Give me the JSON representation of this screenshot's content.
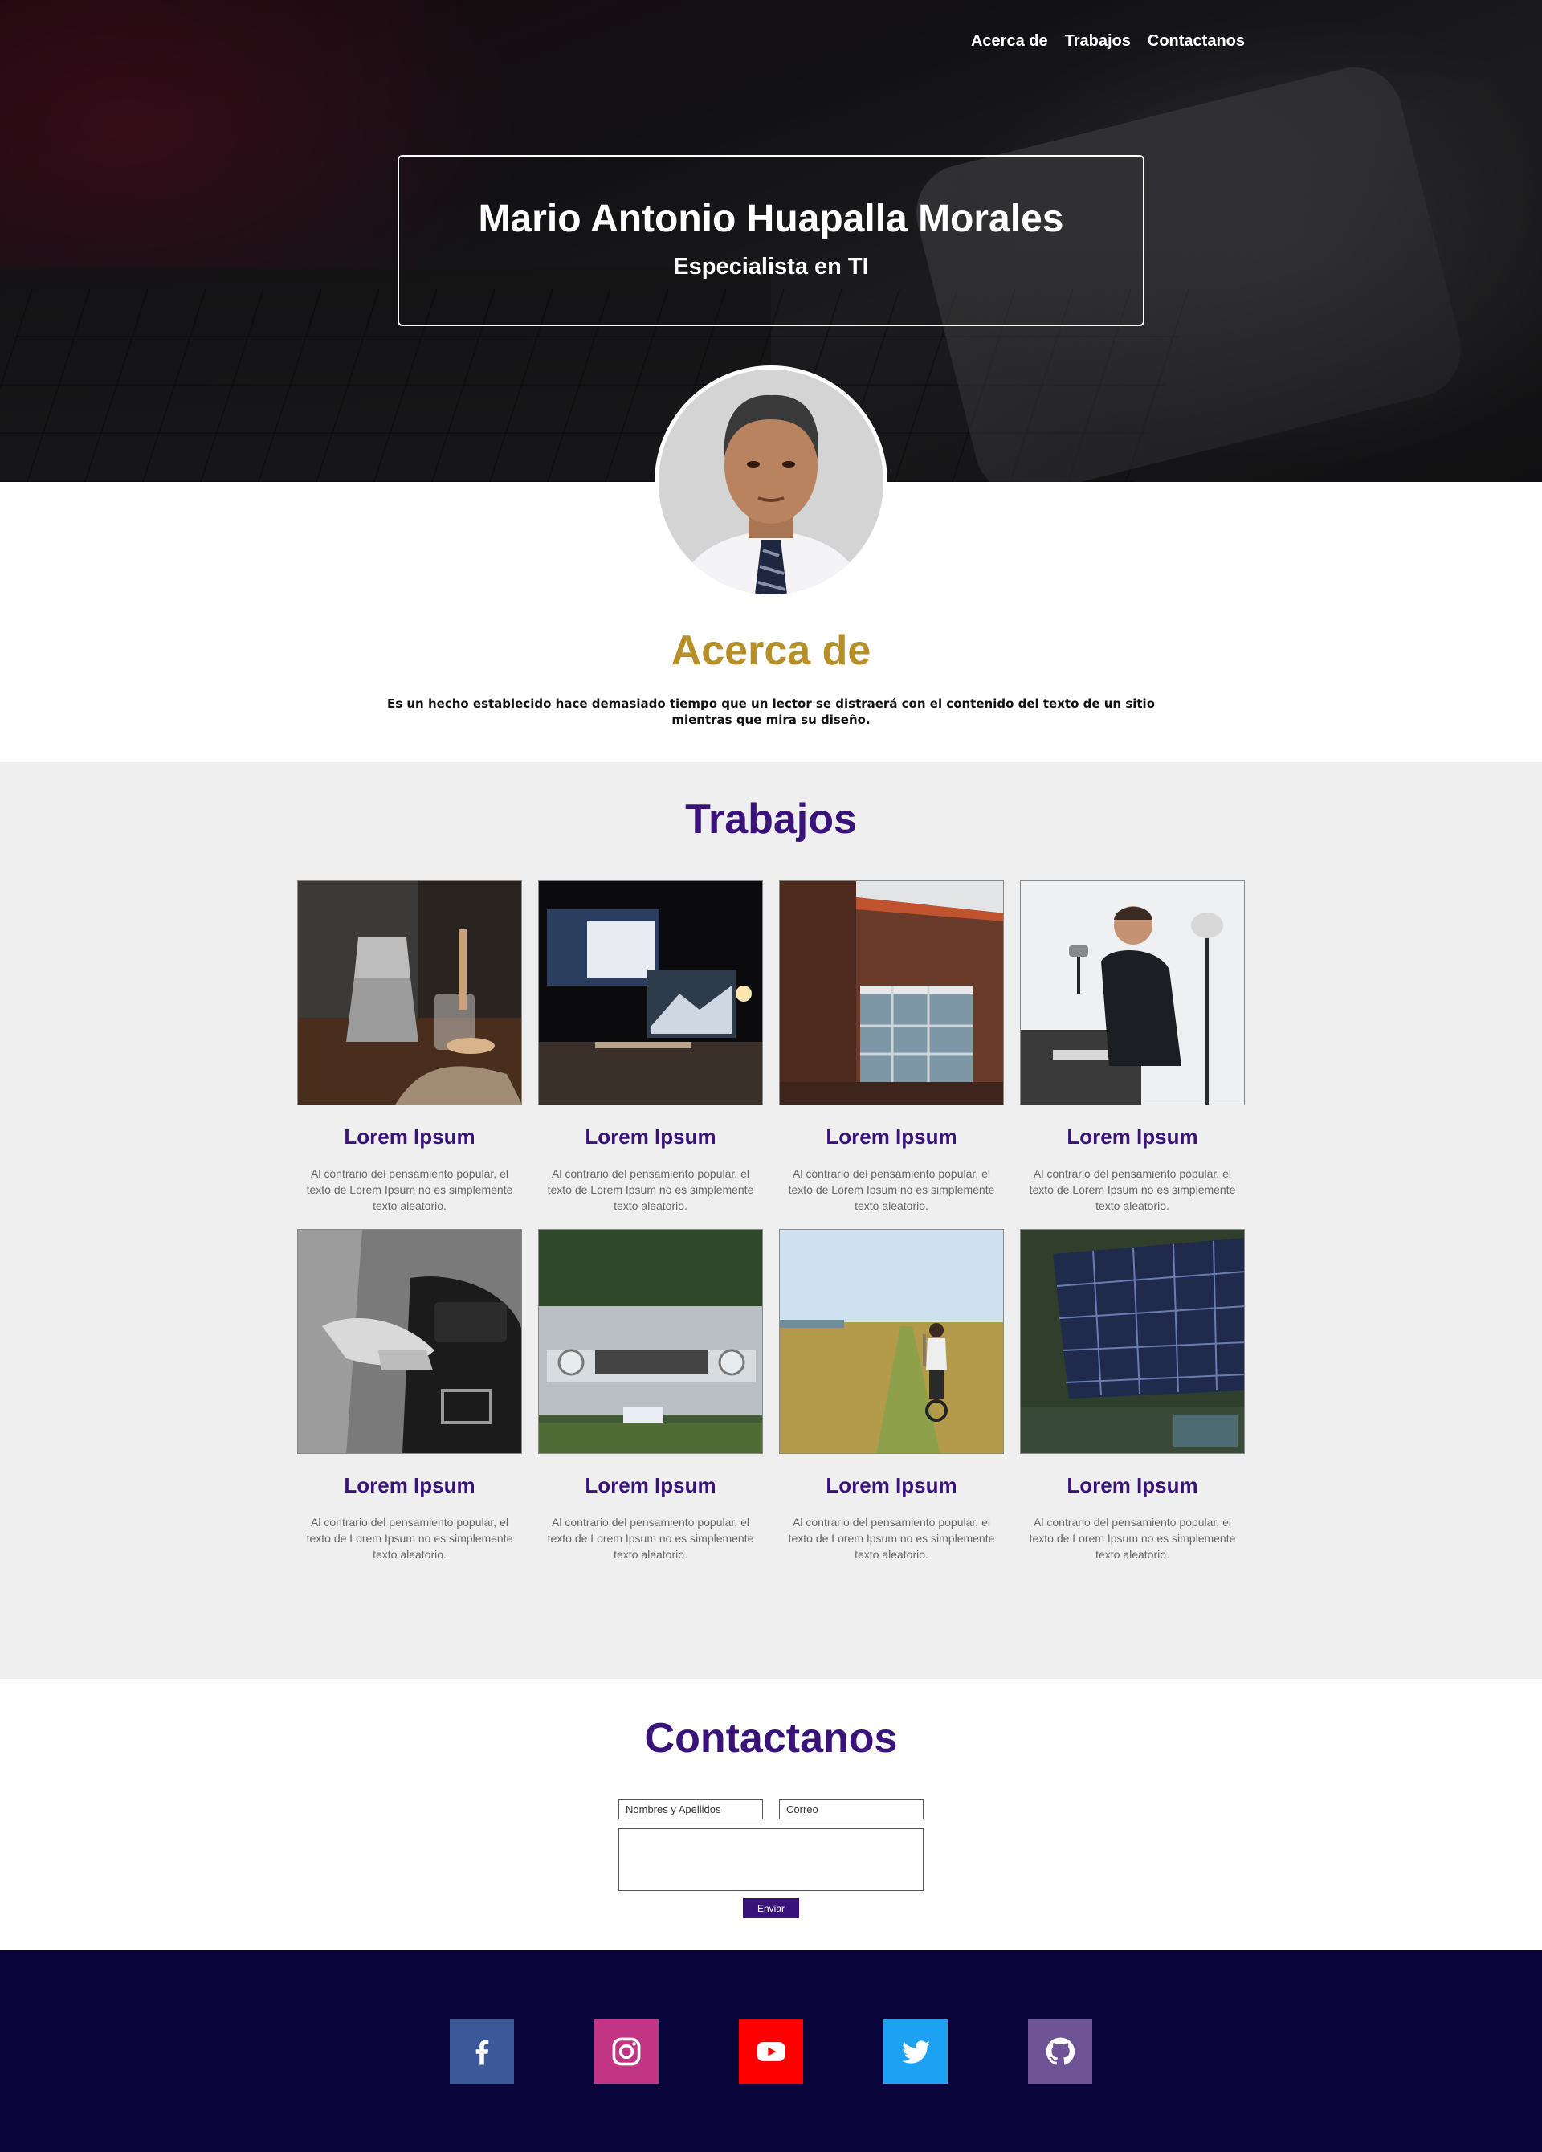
{
  "nav": {
    "items": [
      "Acerca de",
      "Trabajos",
      "Contactanos"
    ]
  },
  "hero": {
    "name": "Mario Antonio Huapalla Morales",
    "role": "Especialista en TI"
  },
  "about": {
    "title": "Acerca de",
    "text": "Es un hecho establecido hace demasiado tiempo que un lector se distraerá con el contenido del texto de un sitio mientras que mira su diseño."
  },
  "works": {
    "title": "Trabajos",
    "items": [
      {
        "title": "Lorem Ipsum",
        "text": "Al contrario del pensamiento popular, el texto de Lorem Ipsum no es simplemente texto aleatorio.",
        "image": "coffee-maker-photo"
      },
      {
        "title": "Lorem Ipsum",
        "text": "Al contrario del pensamiento popular, el texto de Lorem Ipsum no es simplemente texto aleatorio.",
        "image": "desk-computer-photo"
      },
      {
        "title": "Lorem Ipsum",
        "text": "Al contrario del pensamiento popular, el texto de Lorem Ipsum no es simplemente texto aleatorio.",
        "image": "building-facade-photo"
      },
      {
        "title": "Lorem Ipsum",
        "text": "Al contrario del pensamiento popular, el texto de Lorem Ipsum no es simplemente texto aleatorio.",
        "image": "man-at-desk-photo"
      },
      {
        "title": "Lorem Ipsum",
        "text": "Al contrario del pensamiento popular, el texto de Lorem Ipsum no es simplemente texto aleatorio.",
        "image": "handbag-photo"
      },
      {
        "title": "Lorem Ipsum",
        "text": "Al contrario del pensamiento popular, el texto de Lorem Ipsum no es simplemente texto aleatorio.",
        "image": "classic-car-photo"
      },
      {
        "title": "Lorem Ipsum",
        "text": "Al contrario del pensamiento popular, el texto de Lorem Ipsum no es simplemente texto aleatorio.",
        "image": "cyclist-path-photo"
      },
      {
        "title": "Lorem Ipsum",
        "text": "Al contrario del pensamiento popular, el texto de Lorem Ipsum no es simplemente texto aleatorio.",
        "image": "solar-panel-photo"
      }
    ]
  },
  "contact": {
    "title": "Contactanos",
    "name_placeholder": "Nombres y Apellidos",
    "email_placeholder": "Correo",
    "message_value": "",
    "submit_label": "Enviar"
  },
  "footer": {
    "social": [
      {
        "name": "facebook-icon",
        "color": "#3b5998"
      },
      {
        "name": "instagram-icon",
        "color": "#c13584"
      },
      {
        "name": "youtube-icon",
        "color": "#ff0000"
      },
      {
        "name": "twitter-icon",
        "color": "#1da1f2"
      },
      {
        "name": "github-icon",
        "color": "#6e5494"
      }
    ]
  },
  "colors": {
    "accent_purple": "#3a137a",
    "accent_gold": "#b78f29",
    "footer_bg": "#09053a",
    "works_bg": "#efefef"
  }
}
